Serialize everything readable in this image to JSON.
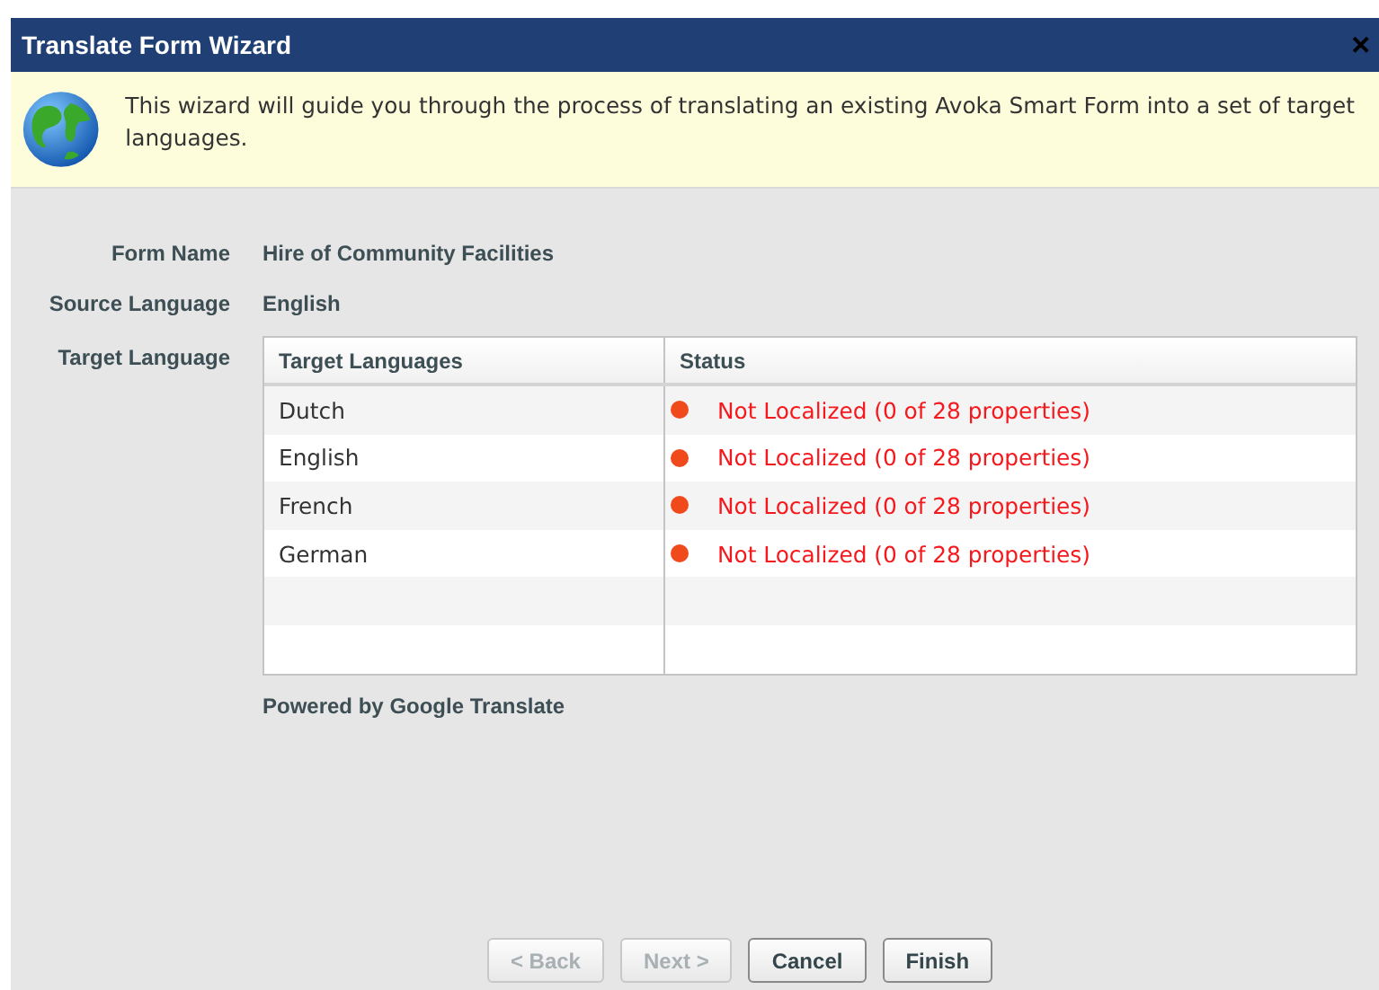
{
  "window": {
    "title": "Translate Form Wizard",
    "close": "✕"
  },
  "banner": {
    "text": "This wizard will guide you through the process of translating an existing Avoka Smart Form into a set of target languages."
  },
  "fields": [
    {
      "label": "Form Name",
      "value": "Hire of Community Facilities"
    },
    {
      "label": "Source Language",
      "value": "English"
    }
  ],
  "target_label": "Target Language",
  "table": {
    "columns": [
      "Target Languages",
      "Status"
    ],
    "rows": [
      {
        "language": "Dutch",
        "status": "Not Localized (0 of 28 properties)",
        "color": "#f04a1c"
      },
      {
        "language": "English",
        "status": "Not Localized (0 of 28 properties)",
        "color": "#f04a1c"
      },
      {
        "language": "French",
        "status": "Not Localized (0 of 28 properties)",
        "color": "#f04a1c"
      },
      {
        "language": "German",
        "status": "Not Localized (0 of 28 properties)",
        "color": "#f04a1c"
      }
    ]
  },
  "powered_by": "Powered by Google Translate",
  "buttons": [
    {
      "label": "< Back",
      "disabled": true
    },
    {
      "label": "Next >",
      "disabled": true
    },
    {
      "label": "Cancel",
      "disabled": false
    },
    {
      "label": "Finish",
      "disabled": false
    }
  ]
}
